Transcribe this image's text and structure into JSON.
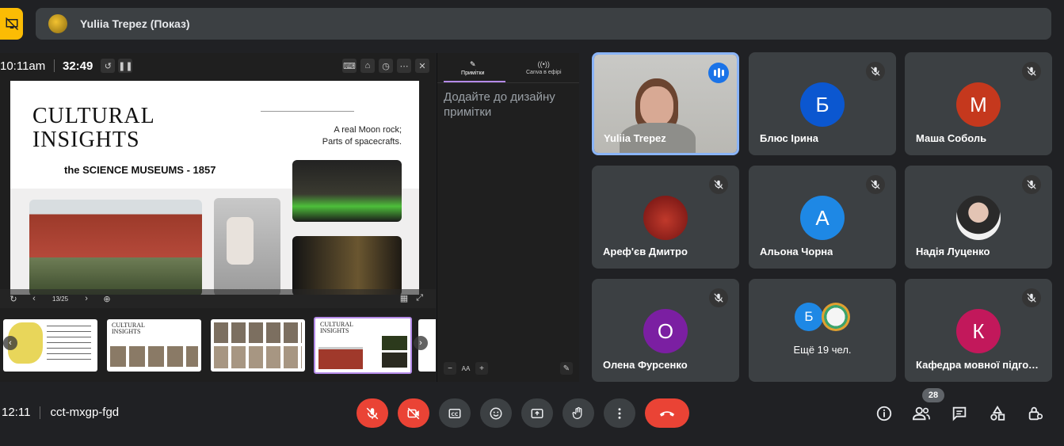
{
  "presenter_bar": {
    "name": "Yuliia Trepez (Показ)"
  },
  "presentation": {
    "clock": "10:11am",
    "timer": "32:49",
    "page_indicator": "13/25",
    "slide": {
      "title_line1": "CULTURAL",
      "title_line2": "INSIGHTS",
      "subtitle": "the SCIENCE MUSEUMS - 1857",
      "note_line1": "A real Moon rock;",
      "note_line2": "Parts of spacecrafts."
    },
    "thumbnails": [
      {
        "title": ""
      },
      {
        "title": "CULTURAL\nINSIGHTS"
      },
      {
        "title": ""
      },
      {
        "title": "CULTURAL\nINSIGHTS"
      }
    ]
  },
  "notes_panel": {
    "tab_notes": "Примітки",
    "tab_live": "Canva в ефірі",
    "placeholder": "Додайте до дизайну примітки",
    "zoom_label": "AA"
  },
  "participants": [
    {
      "name": "Yuliia Trepez",
      "type": "video",
      "speaking": true
    },
    {
      "name": "Блюс Ірина",
      "initial": "Б",
      "color": "#0b57d0",
      "muted": true
    },
    {
      "name": "Маша Соболь",
      "initial": "М",
      "color": "#c5381d",
      "muted": true
    },
    {
      "name": "Ареф'єв Дмитро",
      "initial": "",
      "color": "#8b1a1a",
      "muted": true
    },
    {
      "name": "Альона Чорна",
      "initial": "А",
      "color": "#1e88e5",
      "muted": true
    },
    {
      "name": "Надія Луценко",
      "initial": "",
      "color": "#f1f1f1",
      "muted": true
    },
    {
      "name": "Олена Фурсенко",
      "initial": "О",
      "color": "#7b1fa2",
      "muted": true
    },
    {
      "name": "Ещё 19 чел.",
      "initial": "Б",
      "color": "#1e88e5"
    },
    {
      "name": "Кафедра мовної підготовки",
      "initial": "К",
      "color": "#c2185b",
      "muted": true
    }
  ],
  "meeting": {
    "time": "12:11",
    "code": "cct-mxgp-fgd",
    "participants_count": "28"
  },
  "colors": {
    "accent_blue": "#8ab4f8",
    "end_call": "#ea4335",
    "present_yellow": "#fbbc04"
  }
}
